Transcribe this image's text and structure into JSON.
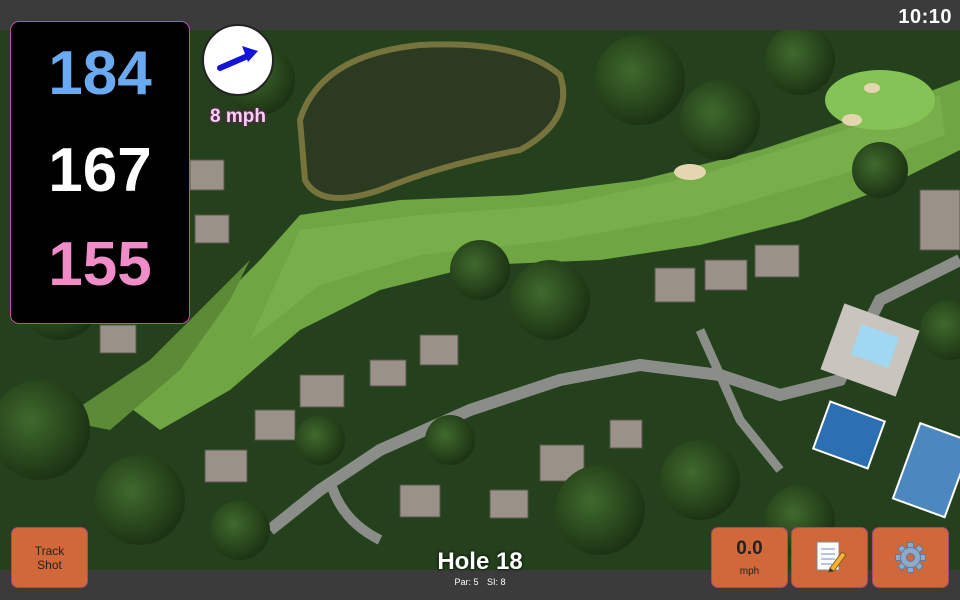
{
  "status": {
    "time": "10:10"
  },
  "yardages": {
    "back": "184",
    "center": "167",
    "front": "155",
    "colors": {
      "back": "#6aaaf0",
      "center": "#ffffff",
      "front": "#f08cc8"
    }
  },
  "wind": {
    "speed_text": "8 mph",
    "icon": "wind-direction-arrow-icon",
    "arrow_color": "#1414d8"
  },
  "buttons": {
    "track_line1": "Track",
    "track_line2": "Shot",
    "speed_value": "0.0",
    "speed_unit": "mph",
    "notes_icon": "notepad-pencil-icon",
    "settings_icon": "gear-icon",
    "button_color": "#d0683a"
  },
  "hole": {
    "title": "Hole 18",
    "par": "Par: 5",
    "si": "SI: 8"
  },
  "map": {
    "type": "satellite-aerial",
    "features": [
      "pond",
      "fairway",
      "green",
      "bunkers",
      "houses",
      "road",
      "tennis-courts",
      "pool"
    ]
  }
}
